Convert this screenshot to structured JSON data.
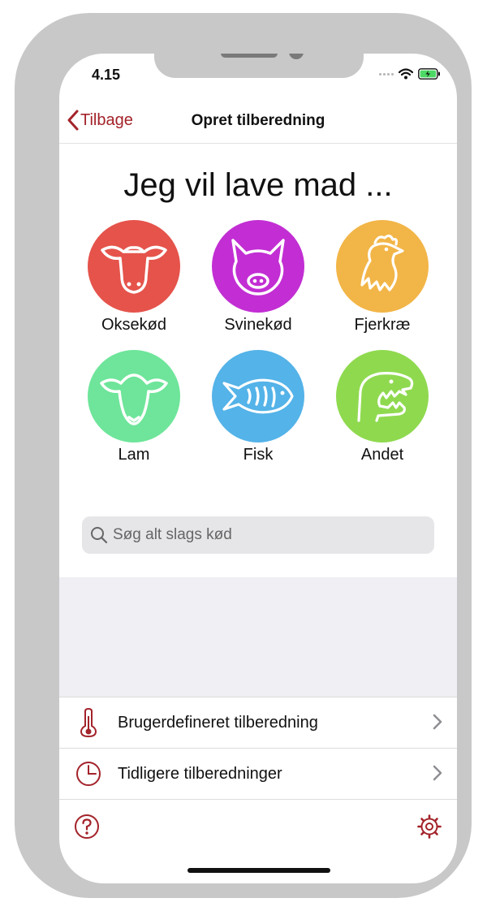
{
  "status": {
    "time": "4.15"
  },
  "nav": {
    "back_label": "Tilbage",
    "title": "Opret tilberedning"
  },
  "heading": "Jeg vil lave mad ...",
  "categories": [
    {
      "label": "Oksekød",
      "color": "#e5534b",
      "icon": "cow-icon"
    },
    {
      "label": "Svinekød",
      "color": "#c22ed3",
      "icon": "pig-icon"
    },
    {
      "label": "Fjerkræ",
      "color": "#f2b547",
      "icon": "chicken-icon"
    },
    {
      "label": "Lam",
      "color": "#6ee59a",
      "icon": "sheep-icon"
    },
    {
      "label": "Fisk",
      "color": "#54b3e8",
      "icon": "fish-icon"
    },
    {
      "label": "Andet",
      "color": "#8fd94f",
      "icon": "dinosaur-icon"
    }
  ],
  "search": {
    "placeholder": "Søg alt slags kød"
  },
  "list": [
    {
      "label": "Brugerdefineret tilberedning",
      "icon": "thermometer-icon"
    },
    {
      "label": "Tidligere tilberedninger",
      "icon": "clock-icon"
    }
  ],
  "toolbar": {
    "help_icon": "help-icon",
    "settings_icon": "gear-icon"
  },
  "accent": "#a3232a"
}
